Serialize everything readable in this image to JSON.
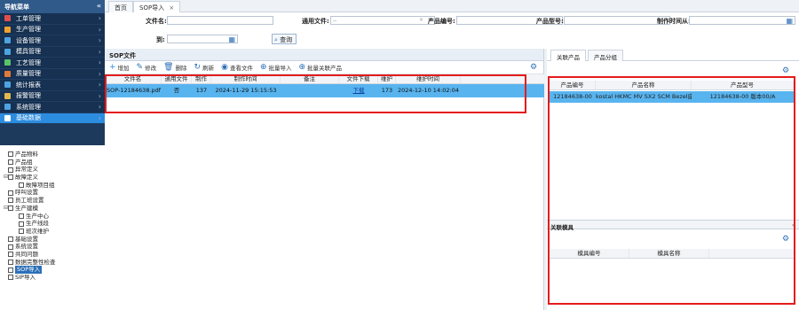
{
  "sidebar": {
    "title": "导航菜单",
    "collapse": "«",
    "menu": [
      {
        "label": "工单管理",
        "icon": "doc-icon"
      },
      {
        "label": "生产管理",
        "icon": "gear-icon"
      },
      {
        "label": "设备管理",
        "icon": "device-icon"
      },
      {
        "label": "模具管理",
        "icon": "mold-icon"
      },
      {
        "label": "工艺管理",
        "icon": "process-icon"
      },
      {
        "label": "质量管理",
        "icon": "quality-icon"
      },
      {
        "label": "统计报表",
        "icon": "chart-icon"
      },
      {
        "label": "报警管理",
        "icon": "alarm-icon"
      },
      {
        "label": "系统管理",
        "icon": "system-icon"
      },
      {
        "label": "基础数据",
        "icon": "base-icon"
      }
    ],
    "tree": [
      {
        "label": "产品物料",
        "depth": 0
      },
      {
        "label": "产品组",
        "depth": 0
      },
      {
        "label": "异常定义",
        "depth": 0
      },
      {
        "label": "故障定义",
        "depth": 0,
        "toggle": "⊟"
      },
      {
        "label": "故障项目组",
        "depth": 1
      },
      {
        "label": "呼叫设置",
        "depth": 0
      },
      {
        "label": "员工班设置",
        "depth": 0
      },
      {
        "label": "生产建模",
        "depth": 0,
        "toggle": "⊟"
      },
      {
        "label": "生产中心",
        "depth": 1
      },
      {
        "label": "生产线段",
        "depth": 1
      },
      {
        "label": "班次维护",
        "depth": 1
      },
      {
        "label": "基础设置",
        "depth": 0
      },
      {
        "label": "系统设置",
        "depth": 0
      },
      {
        "label": "共同问题",
        "depth": 0
      },
      {
        "label": "数据完整性检查",
        "depth": 0
      },
      {
        "label": "SOP导入",
        "depth": 0,
        "selected": true
      },
      {
        "label": "SIP导入",
        "depth": 0
      }
    ]
  },
  "tabs": [
    {
      "label": "首页",
      "active": false
    },
    {
      "label": "SOP导入",
      "active": true,
      "close": "×"
    }
  ],
  "search": {
    "file_name_label": "文件名:",
    "applicable_label": "通用文件:",
    "applicable_value": "--",
    "product_no_label": "产品编号:",
    "product_model_label": "产品型号:",
    "create_from_label": "制作时间从:",
    "to_label": "到:",
    "search_button": "查询",
    "clear": "×",
    "dropdown": "∨"
  },
  "sop_panel": {
    "title": "SOP文件",
    "toolbar": [
      {
        "label": "增加",
        "icon": "plus-icon",
        "glyph": "+"
      },
      {
        "label": "修改",
        "icon": "pencil-icon",
        "glyph": "✎"
      },
      {
        "label": "删除",
        "icon": "trash-icon",
        "glyph": "🗑"
      },
      {
        "label": "刷新",
        "icon": "refresh-icon",
        "glyph": "↻"
      },
      {
        "label": "查看文件",
        "icon": "eye-icon",
        "glyph": "◉"
      },
      {
        "label": "批量导入",
        "icon": "import-icon",
        "glyph": "⊕"
      },
      {
        "label": "批量关联产品",
        "icon": "link-icon",
        "glyph": "⊕"
      }
    ],
    "columns": [
      "文件名",
      "通用文件",
      "制作",
      "制作时间",
      "备注",
      "文件下载",
      "维护",
      "维护时间"
    ],
    "rows": [
      [
        "SOP-12184638.pdf",
        "否",
        "137",
        "2024-11-29 15:15:53",
        "",
        "下载",
        "173",
        "2024-12-10 14:02:04"
      ]
    ]
  },
  "right_panel": {
    "tabs": [
      {
        "label": "关联产品",
        "active": true
      },
      {
        "label": "产品分组",
        "active": false
      }
    ],
    "columns": [
      "产品编号",
      "产品名称",
      "产品型号"
    ],
    "rows": [
      [
        "12184638-00",
        "kostal HKMC MV SX2 SCM Bezel座",
        "12184638-00 版本00/A"
      ]
    ],
    "mold_section": {
      "title": "关联模具",
      "expand": "»",
      "columns": [
        "模具编号",
        "模具名称"
      ]
    }
  },
  "colors": {
    "sidebar_bg": "#1d3a5c",
    "selection": "#58b4ef",
    "highlight_box": "#e41b1b",
    "accent": "#2c6fb8"
  }
}
